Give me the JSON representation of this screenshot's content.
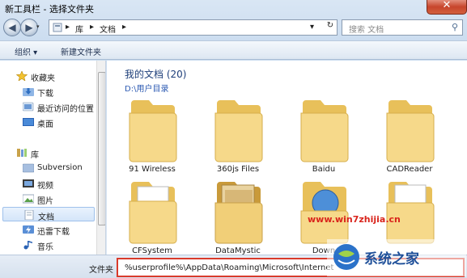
{
  "window": {
    "title": "新工具栏 - 选择文件夹",
    "close_glyph": "✕"
  },
  "navigation": {
    "back_glyph": "◀",
    "forward_glyph": "▶",
    "dropdown_glyph": "▾"
  },
  "address_bar": {
    "sep1": "▸",
    "part1": "库",
    "sep2": "▸",
    "part2": "文档",
    "sep3": "▸",
    "dropdown_glyph": "▾",
    "refresh_glyph": "↻"
  },
  "search": {
    "placeholder": "搜索 文档",
    "icon": "search-icon",
    "icon_glyph": "⚲"
  },
  "toolbar": {
    "organize_label": "组织 ▾",
    "new_folder_label": "新建文件夹"
  },
  "sidebar": {
    "items": [
      {
        "label": "收藏夹",
        "icon": "favorites-star-icon"
      },
      {
        "label": "下载",
        "icon": "download-folder-icon"
      },
      {
        "label": "最近访问的位置",
        "icon": "recent-places-icon"
      },
      {
        "label": "桌面",
        "icon": "desktop-icon"
      },
      {
        "label": "库",
        "icon": "libraries-icon"
      },
      {
        "label": "Subversion",
        "icon": "subversion-library-icon"
      },
      {
        "label": "视频",
        "icon": "videos-icon"
      },
      {
        "label": "图片",
        "icon": "pictures-icon"
      },
      {
        "label": "文档",
        "icon": "documents-icon"
      },
      {
        "label": "迅雷下载",
        "icon": "thunder-download-icon"
      },
      {
        "label": "音乐",
        "icon": "music-icon"
      }
    ]
  },
  "content": {
    "library_title": "我的文档 (20)",
    "library_path": "D:\\用户目录",
    "folders": [
      {
        "name": "91 Wireless"
      },
      {
        "name": "360js Files"
      },
      {
        "name": "Baidu"
      },
      {
        "name": "CADReader"
      },
      {
        "name": "CFSystem"
      },
      {
        "name": "DataMystic"
      },
      {
        "name": "Down"
      },
      {
        "name": ""
      }
    ]
  },
  "footer": {
    "filename_label": "文件夹",
    "filename_value": "%userprofile%\\AppData\\Roaming\\Microsoft\\Internet"
  },
  "watermark": {
    "url": "www.win7zhijia.cn",
    "brand": "系统之家"
  },
  "colors": {
    "accent_red": "#d93a2b",
    "folder_yellow": "#f3d37a",
    "selection_blue": "#d4e5f9"
  }
}
